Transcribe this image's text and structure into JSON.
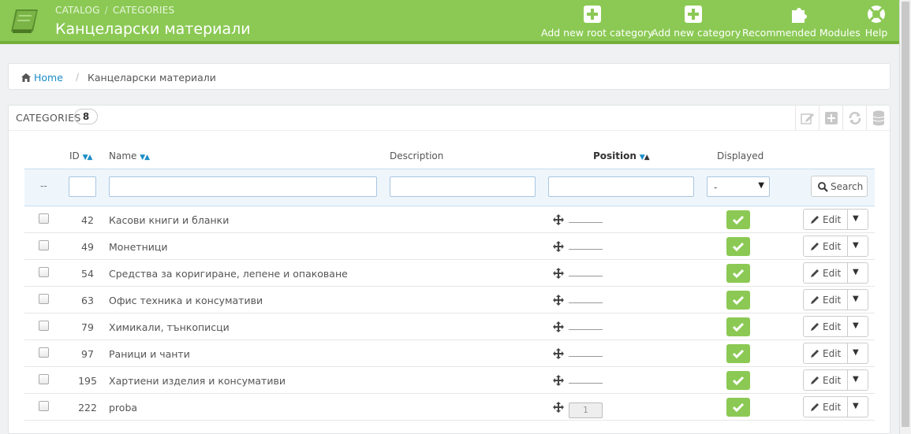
{
  "header": {
    "breadcrumb": [
      "CATALOG",
      "CATEGORIES"
    ],
    "title": "Канцеларски материали",
    "toolbar": [
      {
        "label": "Add new root category",
        "icon": "plus-square-icon"
      },
      {
        "label": "Add new category",
        "icon": "plus-square-icon"
      },
      {
        "label": "Recommended Modules",
        "icon": "puzzle-icon"
      },
      {
        "label": "Help",
        "icon": "lifebuoy-icon"
      }
    ]
  },
  "breadcrumb": {
    "home": "Home",
    "current": "Канцеларски материали"
  },
  "panel": {
    "title": "CATEGORIES",
    "count": "8",
    "columns": {
      "id": "ID",
      "name": "Name",
      "description": "Description",
      "position": "Position",
      "displayed": "Displayed"
    },
    "filter": {
      "dash": "--",
      "displayed_value": "-",
      "search_label": "Search"
    },
    "edit_label": "Edit",
    "rows": [
      {
        "id": "42",
        "name": "Касови книги и бланки",
        "position": ""
      },
      {
        "id": "49",
        "name": "Монетници",
        "position": ""
      },
      {
        "id": "54",
        "name": "Средства за коригиране, лепене и опаковане",
        "position": ""
      },
      {
        "id": "63",
        "name": "Офис техника и консумативи",
        "position": ""
      },
      {
        "id": "79",
        "name": "Химикали, тънкописци",
        "position": ""
      },
      {
        "id": "97",
        "name": "Раници и чанти",
        "position": ""
      },
      {
        "id": "195",
        "name": "Хартиени изделия и консумативи",
        "position": ""
      },
      {
        "id": "222",
        "name": "proba",
        "position": "1"
      }
    ]
  },
  "colors": {
    "header_green": "#8bc954",
    "link_blue": "#1a8cc6",
    "filter_bg": "#eef6fc"
  }
}
